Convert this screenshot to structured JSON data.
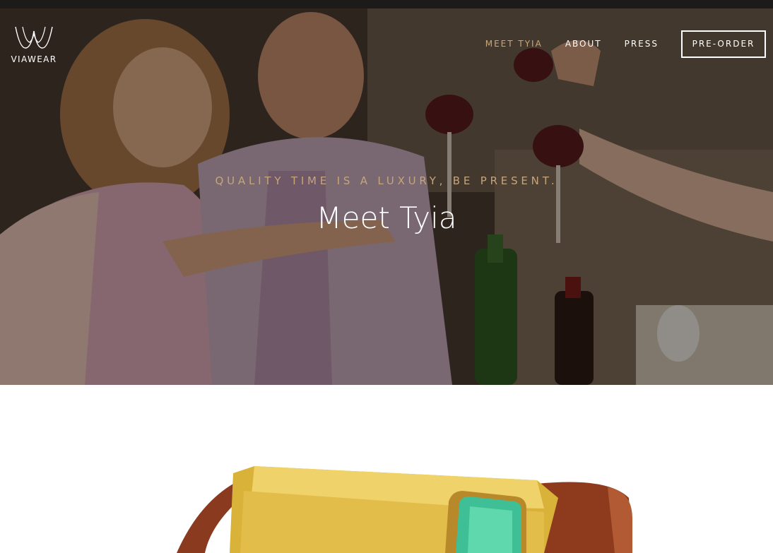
{
  "brand": {
    "name": "VIAWEAR",
    "logo_icon": "viawear-logo-icon"
  },
  "nav": {
    "items": [
      {
        "label": "MEET TYIA",
        "active": true
      },
      {
        "label": "ABOUT",
        "active": false
      },
      {
        "label": "PRESS",
        "active": false
      }
    ],
    "cta_label": "PRE-ORDER"
  },
  "hero": {
    "kicker": "QUALITY TIME IS A LUXURY, BE PRESENT.",
    "title": "Meet Tyia",
    "image": "friends-toasting-wine-photo"
  },
  "product": {
    "image": "tyia-gold-bracelet-photo"
  },
  "colors": {
    "accent_gold": "#c9a87a",
    "nav_text": "#ffffff",
    "hero_overlay": "#000000"
  }
}
